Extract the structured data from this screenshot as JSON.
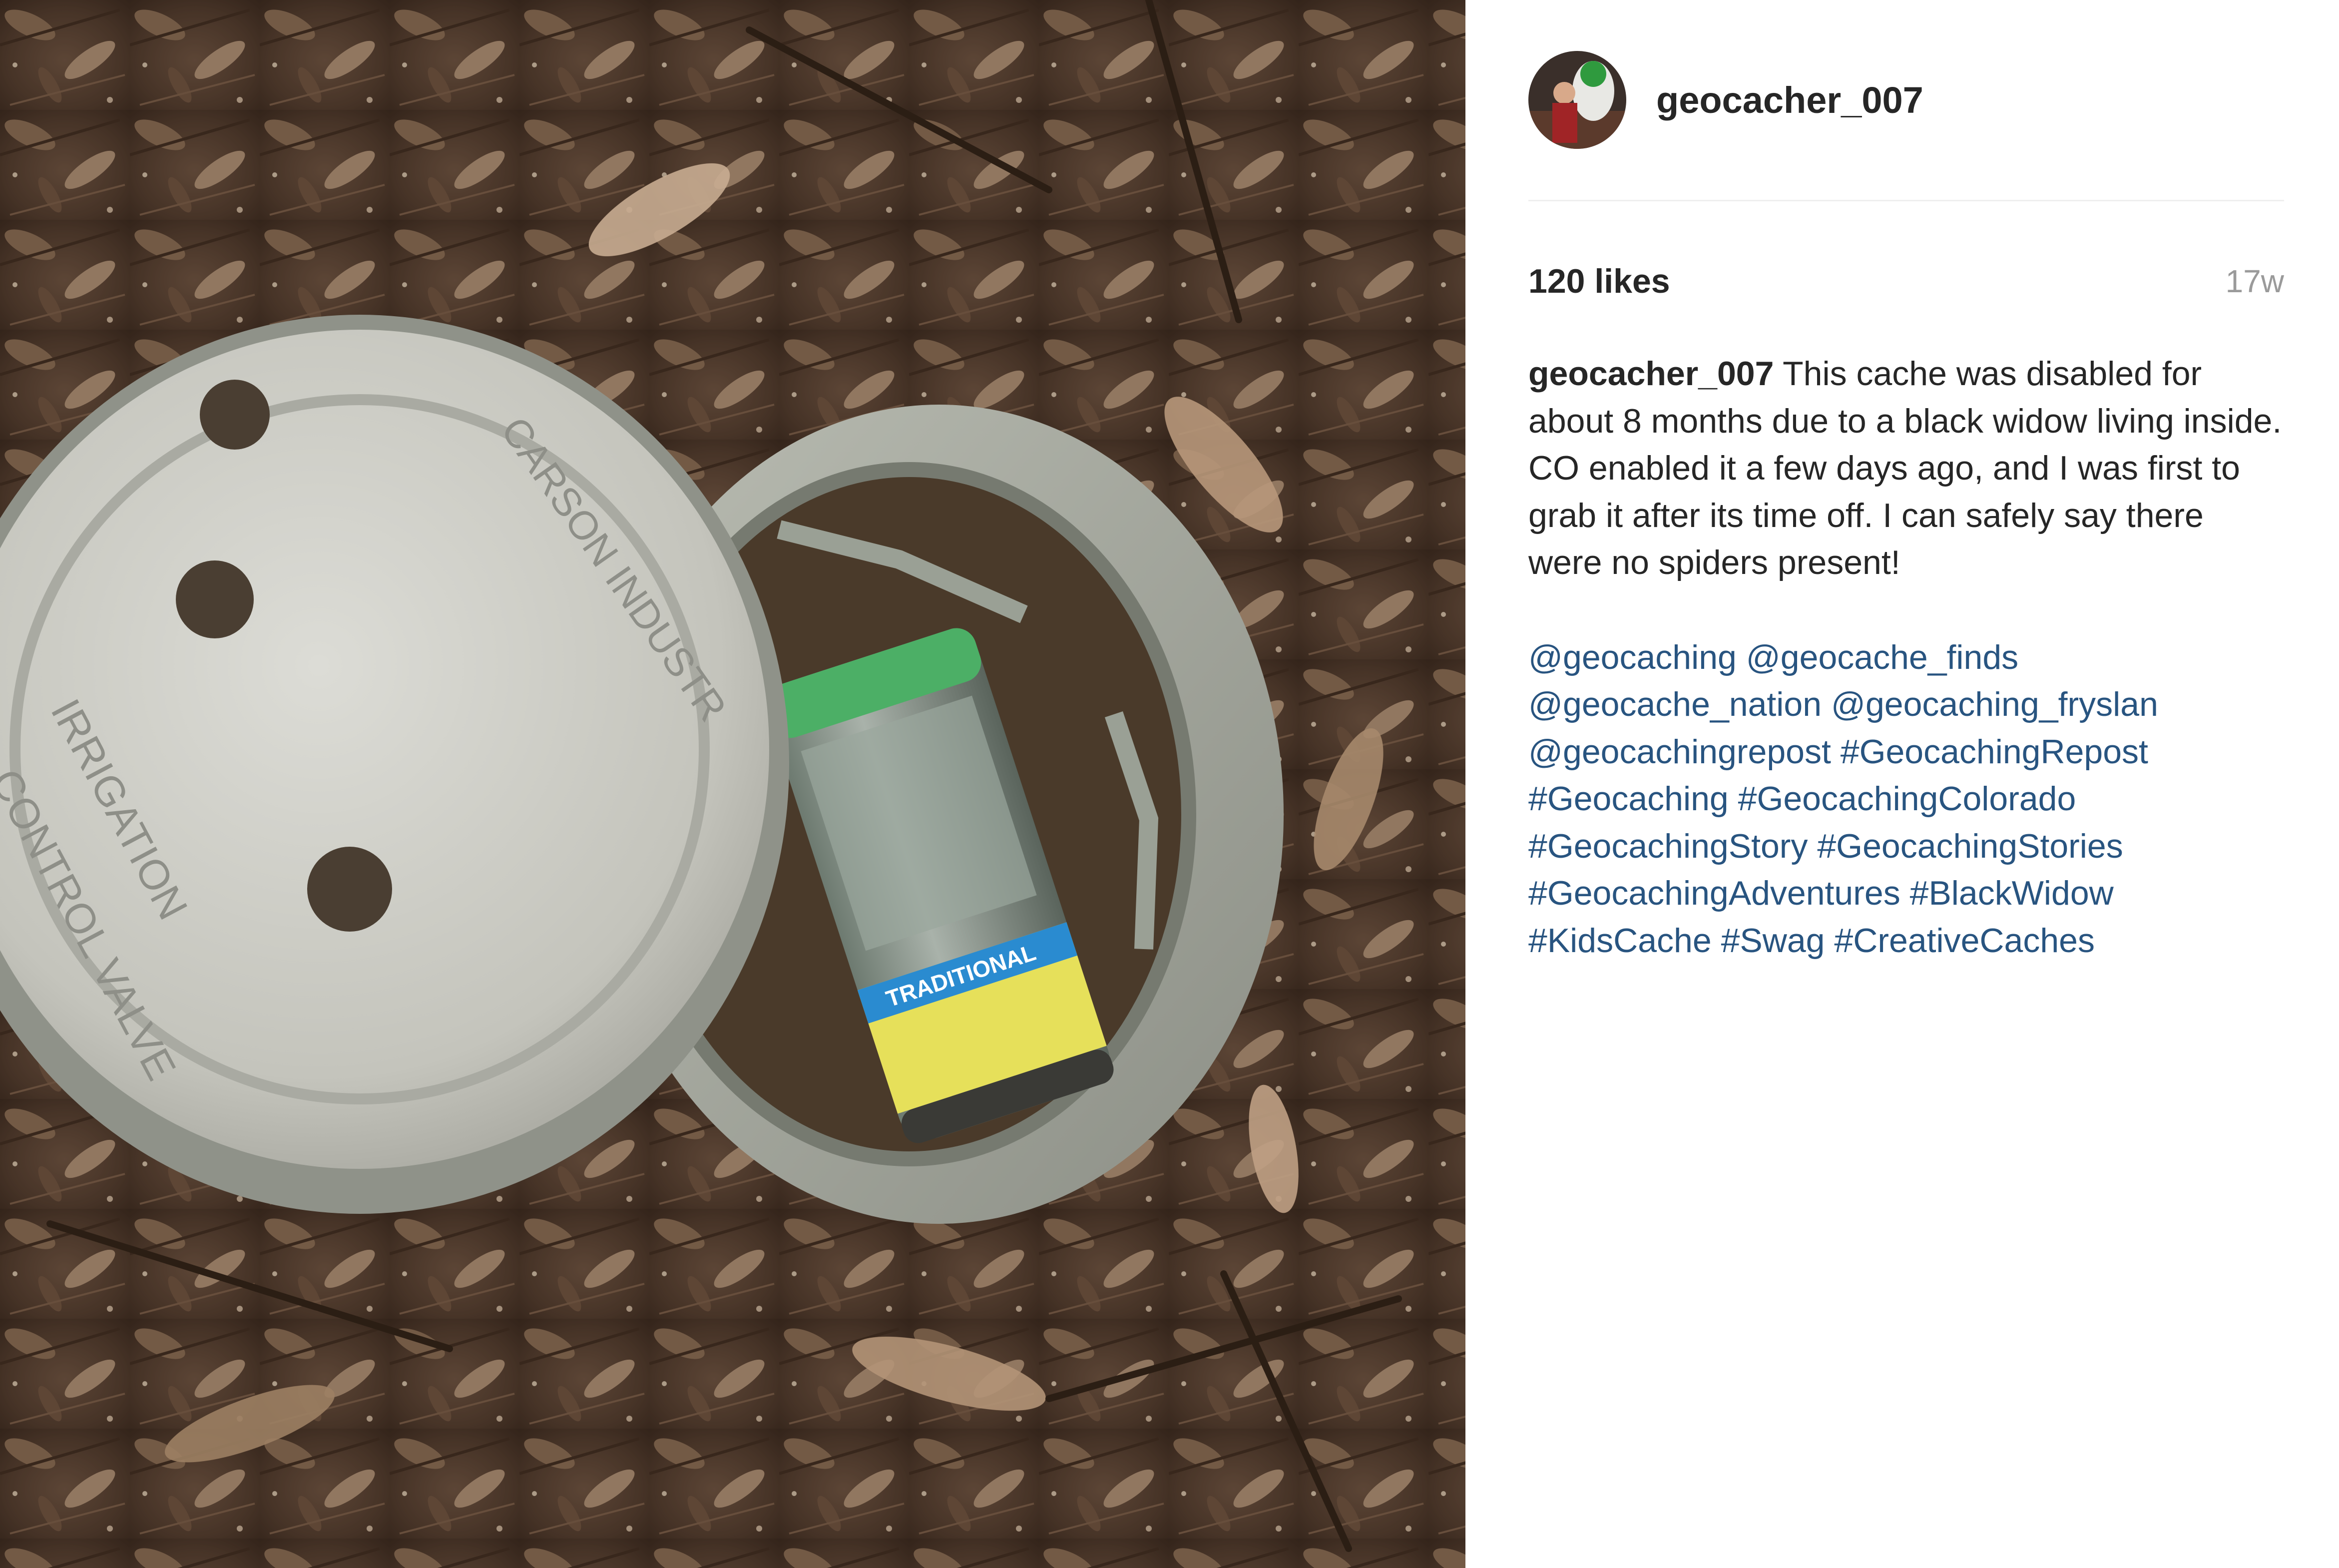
{
  "post": {
    "username": "geocacher_007",
    "likes": "120 likes",
    "time_ago": "17w",
    "caption": {
      "username": "geocacher_007",
      "text": "This cache was disabled for about 8 months due to a black widow living inside. CO enabled it a few days ago, and I was first to grab it after its time off. I can safely say there were no spiders present!"
    },
    "tags": [
      "@geocaching",
      "@geocache_finds",
      "@geocache_nation",
      "@geocaching_fryslan",
      "@geocachingrepost",
      "#GeocachingRepost",
      "#Geocaching",
      "#GeocachingColorado",
      "#GeocachingStory",
      "#GeocachingStories",
      "#GeocachingAdventures",
      "#BlackWidow",
      "#KidsCache",
      "#Swag",
      "#CreativeCaches"
    ]
  },
  "photo": {
    "lid_text_top": "CARSON INDUSTR",
    "lid_text_1": "IRRIGATION",
    "lid_text_2": "CONTROL VALVE",
    "label_text": "TRADITIONAL"
  },
  "colors": {
    "link": "#285480",
    "text": "#262626",
    "muted": "#9a9a9a",
    "divider": "#efefef"
  }
}
